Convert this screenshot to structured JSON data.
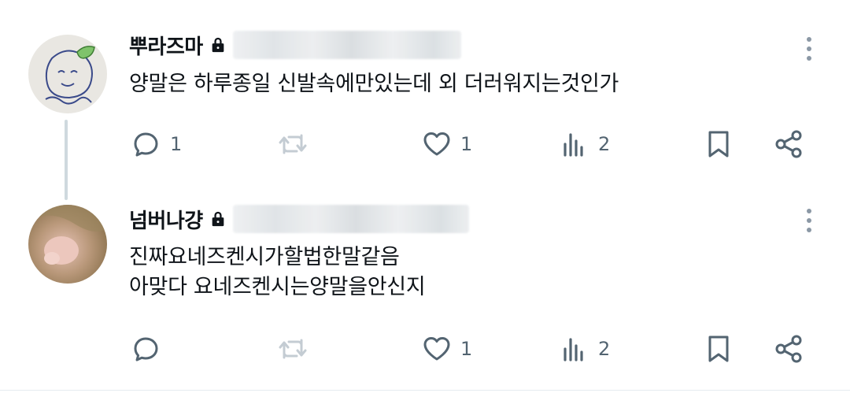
{
  "tweets": [
    {
      "display_name": "뿌라즈마",
      "text_lines": [
        "양말은 하루종일 신발속에만있는데 외 더러워지는것인가"
      ],
      "reply_count": "1",
      "retweet_count": "",
      "like_count": "1",
      "view_count": "2"
    },
    {
      "display_name": "넘버나걍",
      "text_lines": [
        "진짜요네즈켄시가할법한말같음",
        "아맞다 요네즈켄시는양말을안신지"
      ],
      "reply_count": "",
      "retweet_count": "",
      "like_count": "1",
      "view_count": "2"
    }
  ],
  "icons": {
    "reply": "reply-icon",
    "retweet": "retweet-icon",
    "like": "heart-icon",
    "views": "views-icon",
    "bookmark": "bookmark-icon",
    "share": "share-icon",
    "more": "more-icon",
    "lock": "lock-icon"
  },
  "colors": {
    "text": "#0f1419",
    "secondary": "#536471",
    "thread_line": "#cfd9de"
  }
}
